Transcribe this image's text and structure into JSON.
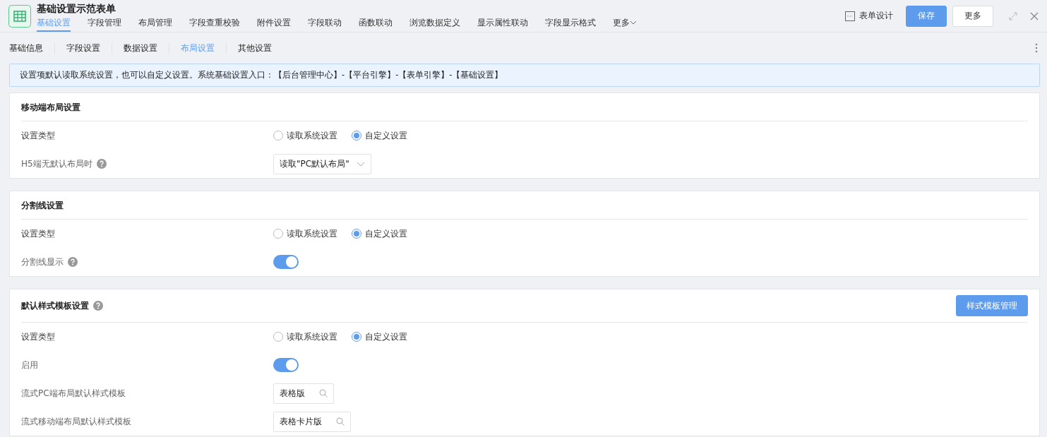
{
  "header": {
    "title": "基础设置示范表单",
    "design_label": "表单设计",
    "save": "保存",
    "more": "更多"
  },
  "tabs": [
    {
      "label": "基础设置",
      "selected": true
    },
    {
      "label": "字段管理",
      "selected": false
    },
    {
      "label": "布局管理",
      "selected": false
    },
    {
      "label": "字段查重校验",
      "selected": false
    },
    {
      "label": "附件设置",
      "selected": false
    },
    {
      "label": "字段联动",
      "selected": false
    },
    {
      "label": "函数联动",
      "selected": false
    },
    {
      "label": "浏览数据定义",
      "selected": false
    },
    {
      "label": "显示属性联动",
      "selected": false
    },
    {
      "label": "字段显示格式",
      "selected": false
    },
    {
      "label": "更多",
      "selected": false
    }
  ],
  "subtabs": [
    {
      "label": "基础信息",
      "selected": false
    },
    {
      "label": "字段设置",
      "selected": false
    },
    {
      "label": "数据设置",
      "selected": false
    },
    {
      "label": "布局设置",
      "selected": true
    },
    {
      "label": "其他设置",
      "selected": false
    }
  ],
  "notice": "设置项默认读取系统设置，也可以自定义设置。系统基础设置入口：【后台管理中心】-【平台引擎】-【表单引擎】-【基础设置】",
  "sections": [
    {
      "title": "移动端布局设置",
      "help": false,
      "rows": [
        {
          "kind": "radio",
          "label": "设置类型",
          "help": false,
          "options": [
            {
              "label": "读取系统设置",
              "selected": false
            },
            {
              "label": "自定义设置",
              "selected": true
            }
          ]
        },
        {
          "kind": "select",
          "label": "H5端无默认布局时",
          "help": true,
          "value": "读取\"PC默认布局\""
        }
      ]
    },
    {
      "title": "分割线设置",
      "help": false,
      "rows": [
        {
          "kind": "radio",
          "label": "设置类型",
          "help": false,
          "options": [
            {
              "label": "读取系统设置",
              "selected": false
            },
            {
              "label": "自定义设置",
              "selected": true
            }
          ]
        },
        {
          "kind": "toggle",
          "label": "分割线显示",
          "help": true,
          "on": true
        }
      ]
    },
    {
      "title": "默认样式模板设置",
      "help": true,
      "action": "样式模板管理",
      "rows": [
        {
          "kind": "radio",
          "label": "设置类型",
          "help": false,
          "options": [
            {
              "label": "读取系统设置",
              "selected": false
            },
            {
              "label": "自定义设置",
              "selected": true
            }
          ]
        },
        {
          "kind": "toggle",
          "label": "启用",
          "help": false,
          "on": true
        },
        {
          "kind": "search",
          "label": "流式PC端布局默认样式模板",
          "help": false,
          "value": "表格版"
        },
        {
          "kind": "search",
          "label": "流式移动端布局默认样式模板",
          "help": false,
          "value": "表格卡片版"
        }
      ]
    }
  ]
}
